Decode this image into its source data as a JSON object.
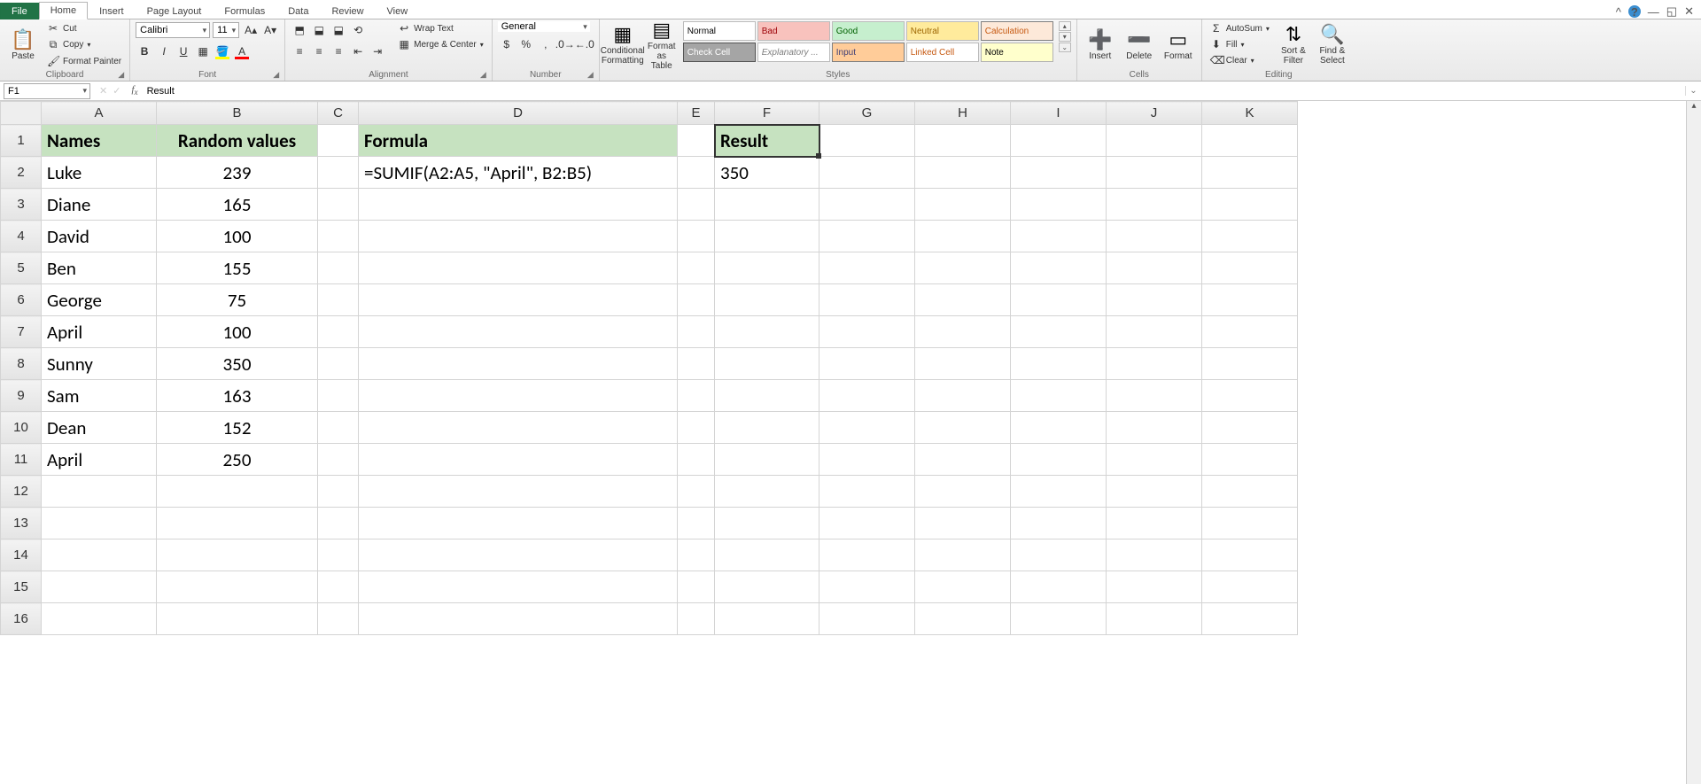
{
  "tabs": {
    "file": "File",
    "home": "Home",
    "insert": "Insert",
    "page_layout": "Page Layout",
    "formulas": "Formulas",
    "data": "Data",
    "review": "Review",
    "view": "View"
  },
  "clipboard": {
    "label": "Clipboard",
    "paste": "Paste",
    "cut": "Cut",
    "copy": "Copy",
    "fp": "Format Painter"
  },
  "font": {
    "label": "Font",
    "name": "Calibri",
    "size": "11"
  },
  "alignment": {
    "label": "Alignment",
    "wrap": "Wrap Text",
    "merge": "Merge & Center"
  },
  "number": {
    "label": "Number",
    "format": "General"
  },
  "styles": {
    "label": "Styles",
    "cond": "Conditional\nFormatting",
    "fmt": "Format\nas Table",
    "cells": [
      {
        "t": "Normal",
        "bg": "#ffffff",
        "c": "#000",
        "bd": "#bbb"
      },
      {
        "t": "Bad",
        "bg": "#f8c2bd",
        "c": "#9c0006",
        "bd": "#bbb"
      },
      {
        "t": "Good",
        "bg": "#c6efce",
        "c": "#006100",
        "bd": "#bbb"
      },
      {
        "t": "Neutral",
        "bg": "#ffeb9c",
        "c": "#9c6500",
        "bd": "#bbb"
      },
      {
        "t": "Calculation",
        "bg": "#fde9d9",
        "c": "#c65911",
        "bd": "#7f7f7f"
      },
      {
        "t": "Check Cell",
        "bg": "#a5a5a5",
        "c": "#ffffff",
        "bd": "#555"
      },
      {
        "t": "Explanatory ...",
        "bg": "#ffffff",
        "c": "#7f7f7f",
        "bd": "#bbb",
        "i": true
      },
      {
        "t": "Input",
        "bg": "#ffcc99",
        "c": "#3f3f76",
        "bd": "#7f7f7f"
      },
      {
        "t": "Linked Cell",
        "bg": "#ffffff",
        "c": "#c65911",
        "bd": "#bbb"
      },
      {
        "t": "Note",
        "bg": "#ffffcc",
        "c": "#000",
        "bd": "#b2b2b2"
      }
    ]
  },
  "cells": {
    "label": "Cells",
    "insert": "Insert",
    "delete": "Delete",
    "format": "Format"
  },
  "editing": {
    "label": "Editing",
    "autosum": "AutoSum",
    "fill": "Fill",
    "clear": "Clear",
    "sort": "Sort &\nFilter",
    "find": "Find &\nSelect"
  },
  "namebox": "F1",
  "formula_value": "Result",
  "columns": [
    "A",
    "B",
    "C",
    "D",
    "E",
    "F",
    "G",
    "H",
    "I",
    "J",
    "K"
  ],
  "row_count": 16,
  "selected": {
    "col": "F",
    "row": 1
  },
  "headers": {
    "A1": "Names",
    "B1": "Random values",
    "D1": "Formula",
    "F1": "Result"
  },
  "data_rows": [
    {
      "name": "Luke",
      "val": "239"
    },
    {
      "name": "Diane",
      "val": "165"
    },
    {
      "name": "David",
      "val": "100"
    },
    {
      "name": "Ben",
      "val": "155"
    },
    {
      "name": "George",
      "val": "75"
    },
    {
      "name": "April",
      "val": "100"
    },
    {
      "name": "Sunny",
      "val": "350"
    },
    {
      "name": "Sam",
      "val": "163"
    },
    {
      "name": "Dean",
      "val": "152"
    },
    {
      "name": "April",
      "val": "250"
    }
  ],
  "D2": "=SUMIF(A2:A5, \"April\", B2:B5)",
  "F2": "350"
}
